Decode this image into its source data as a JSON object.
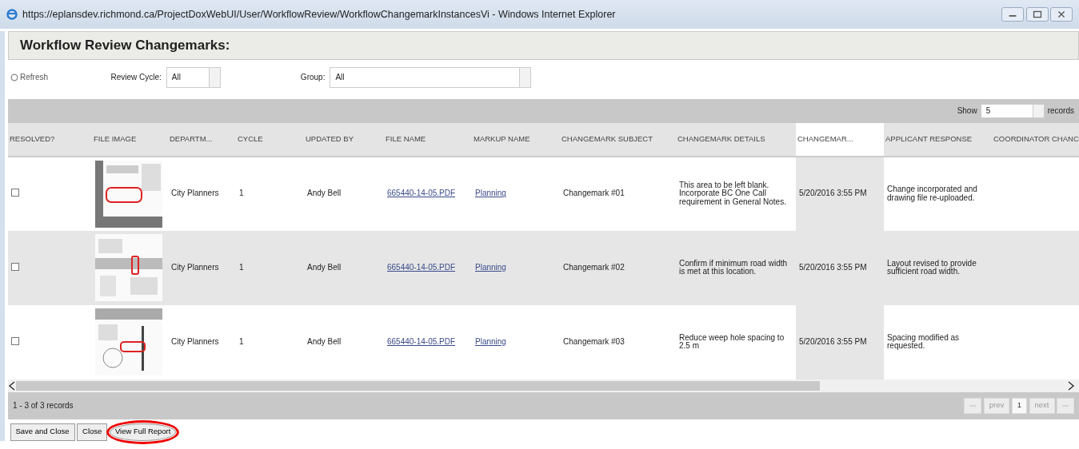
{
  "window": {
    "title": "https://eplansdev.richmond.ca/ProjectDoxWebUI/User/WorkflowReview/WorkflowChangemarkInstancesVi - Windows Internet Explorer"
  },
  "heading": "Workflow Review Changemarks:",
  "toolbar": {
    "refresh": "Refresh",
    "review_cycle": {
      "label": "Review Cycle:",
      "value": "All"
    },
    "group": {
      "label": "Group:",
      "value": "All"
    }
  },
  "page_size": {
    "label": "Show",
    "value": "5",
    "suffix": "records"
  },
  "table": {
    "columns": [
      {
        "label": "RESOLVED?",
        "sorted": false
      },
      {
        "label": "FILE IMAGE",
        "sorted": false
      },
      {
        "label": "DEPARTM...",
        "sorted": false
      },
      {
        "label": "CYCLE",
        "sorted": false
      },
      {
        "label": "UPDATED BY",
        "sorted": false
      },
      {
        "label": "FILE NAME",
        "sorted": false
      },
      {
        "label": "MARKUP NAME",
        "sorted": false
      },
      {
        "label": "CHANGEMARK SUBJECT",
        "sorted": false
      },
      {
        "label": "CHANGEMARK DETAILS",
        "sorted": false
      },
      {
        "label": "CHANGEMAR...",
        "sorted": true
      },
      {
        "label": "APPLICANT RESPONSE",
        "sorted": false
      },
      {
        "label": "COORDINATOR CHANC",
        "sorted": false
      }
    ],
    "rows": [
      {
        "selected": false,
        "resolved": false,
        "department": "City Planners",
        "cycle": "1",
        "updated_by": "Andy Bell",
        "file_name": "665440-14-05.PDF",
        "markup_name": "Planning",
        "subject": "Changemark #01",
        "details": "This area to be left blank. Incorporate BC One Call requirement in General Notes.",
        "date": "5/20/2016 3:55 PM",
        "applicant_response": "Change incorporated and drawing file re-uploaded."
      },
      {
        "selected": true,
        "resolved": false,
        "department": "City Planners",
        "cycle": "1",
        "updated_by": "Andy Bell",
        "file_name": "665440-14-05.PDF",
        "markup_name": "Planning",
        "subject": "Changemark #02",
        "details": "Confirm if minimum road width is met at this location.",
        "date": "5/20/2016 3:55 PM",
        "applicant_response": "Layout revised to provide sufficient road width."
      },
      {
        "selected": false,
        "resolved": false,
        "department": "City Planners",
        "cycle": "1",
        "updated_by": "Andy Bell",
        "file_name": "665440-14-05.PDF",
        "markup_name": "Planning",
        "subject": "Changemark #03",
        "details": "Reduce weep hole spacing to 2.5 m",
        "date": "5/20/2016 3:55 PM",
        "applicant_response": "Spacing modified as requested."
      }
    ]
  },
  "footer": {
    "record_count": "1 - 3 of 3 records",
    "pager": {
      "prev": "prev",
      "page": "1",
      "next": "next"
    }
  },
  "buttons": [
    {
      "label": "Save and Close",
      "circled": false
    },
    {
      "label": "Close",
      "circled": false
    },
    {
      "label": "View Full Report",
      "circled": true
    }
  ]
}
